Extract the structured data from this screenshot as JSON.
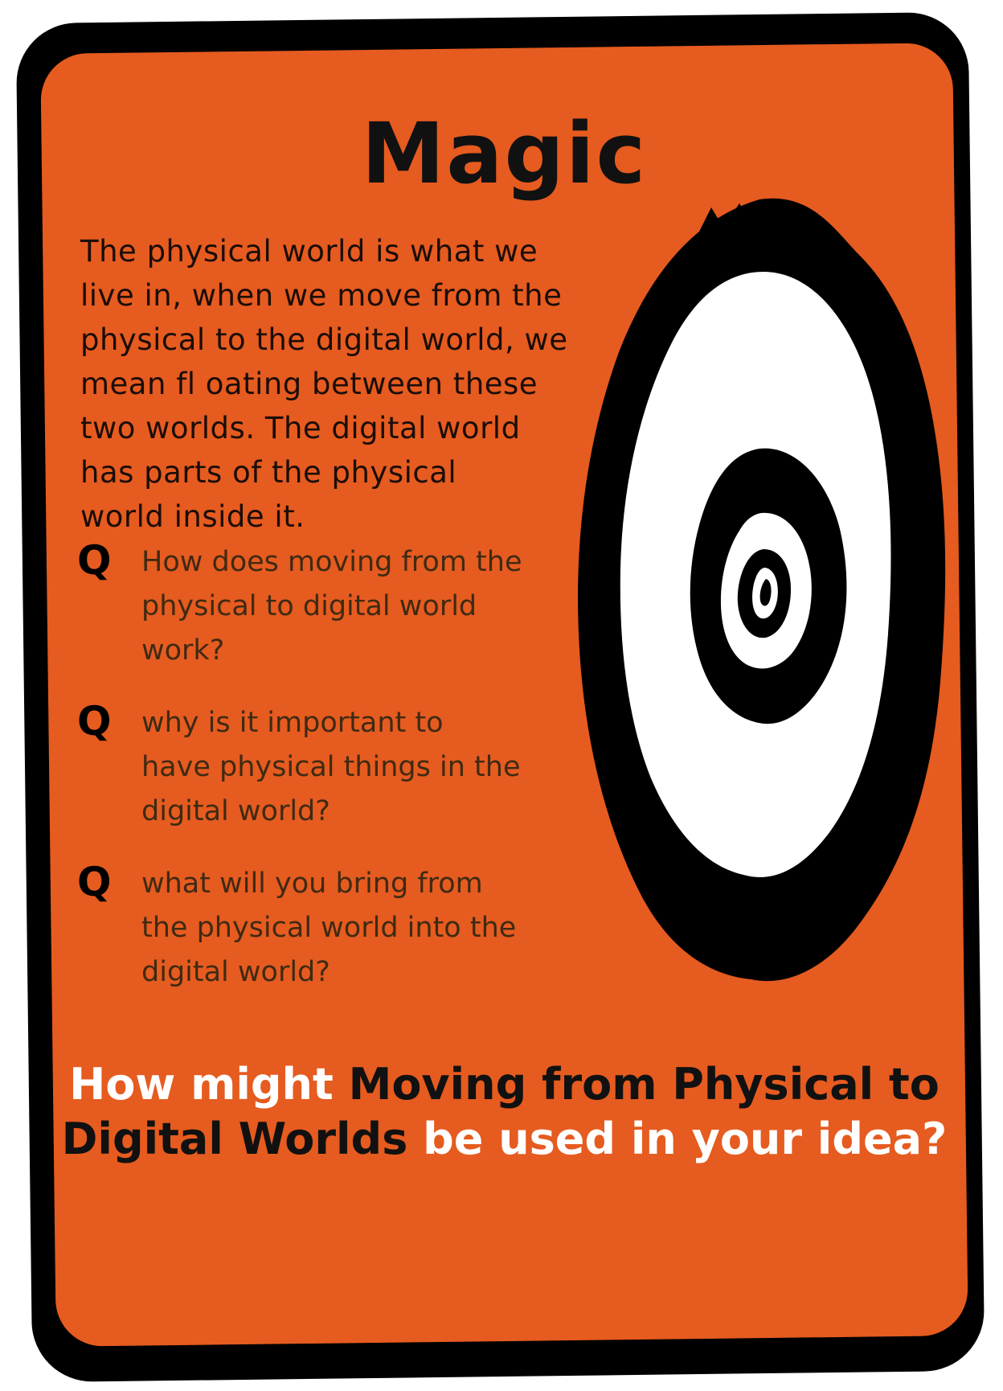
{
  "card": {
    "title": "Magic",
    "intro_lines": [
      "The physical world is what we",
      "live in, when we move from the",
      "physical to the digital world, we",
      "mean fl oating between these",
      "two worlds. The digital world",
      "has parts of the physical",
      "world inside it."
    ],
    "question_marker": "Q",
    "questions": [
      [
        "How does moving from the",
        "physical to digital world",
        "work?"
      ],
      [
        "why is it important to",
        "have physical things in the",
        "digital world?"
      ],
      [
        "what will you bring from",
        "the physical world into the",
        "digital world?"
      ]
    ],
    "footer": {
      "part1": "How might ",
      "part2": "Moving from Physical to",
      "part3": "Digital Worlds",
      "part4": " be used in your idea?"
    },
    "colors": {
      "card": "#e65b1f",
      "border": "#000000",
      "highlight_text": "#ffffff"
    },
    "illustration": "spiral-vortex"
  }
}
